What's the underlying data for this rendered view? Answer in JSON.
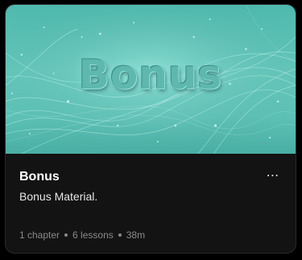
{
  "card": {
    "cover_word": "Bonus",
    "title": "Bonus",
    "description": "Bonus Material.",
    "more_icon": "⋯",
    "meta": {
      "chapters": "1 chapter",
      "lessons": "6 lessons",
      "duration": "38m"
    }
  },
  "colors": {
    "background": "#000000",
    "card": "#131313",
    "cover_accent": "#5ec2b6",
    "title": "#ffffff",
    "meta": "#8a8a8a"
  }
}
